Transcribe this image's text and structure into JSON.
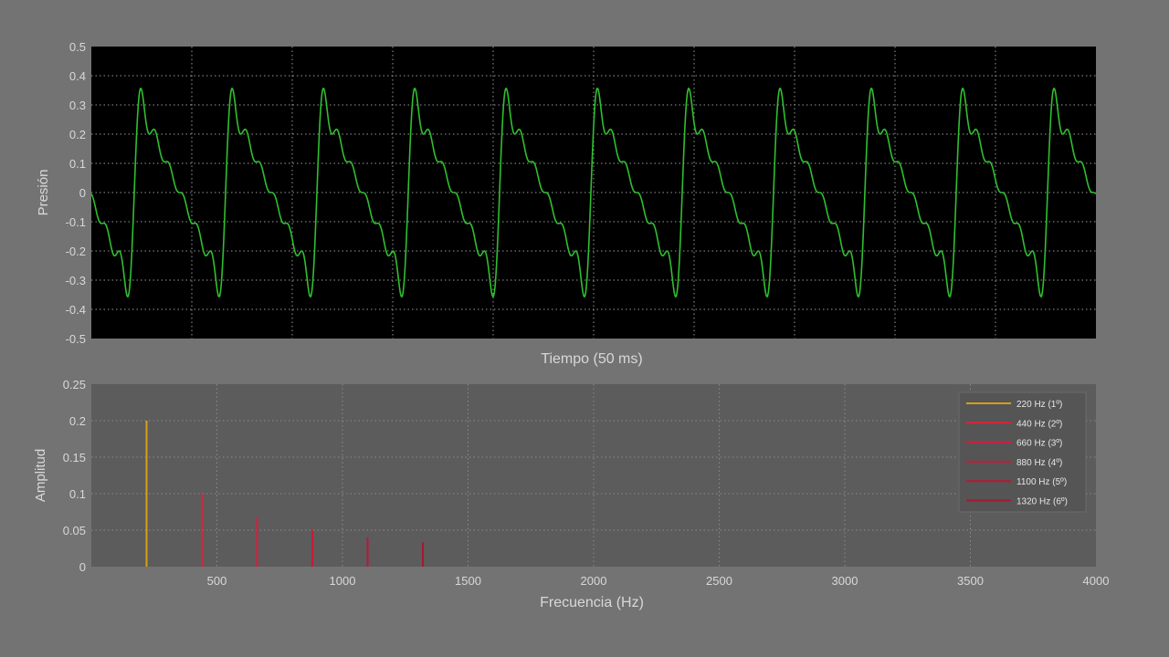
{
  "colors": {
    "background": "#737373",
    "top_plot_bg": "#000000",
    "bottom_plot_bg": "#5c5c5c",
    "wave": "#2fbf2f",
    "tick_text": "#d8d8d8",
    "fundamental": "#d4a017",
    "harmonic": "#d81b3c"
  },
  "chart_data": [
    {
      "type": "line",
      "xlabel": "Tiempo (50 ms)",
      "ylabel": "Presión",
      "ylim": [
        -0.5,
        0.5
      ],
      "yticks": [
        "0.5",
        "0.4",
        "0.3",
        "0.2",
        "0.1",
        "0",
        "-0.1",
        "-0.2",
        "-0.3",
        "-0.4",
        "-0.5"
      ],
      "xlim": [
        0,
        50
      ],
      "xticks_shown": false,
      "grid": true,
      "series": [
        {
          "function": "sum of harmonics 220 Hz fundamental, amplitudes 0.2/0.1/0.0667/0.05/0.04/0.0333",
          "fundamental_hz": 220,
          "amplitudes": [
            0.2,
            0.1,
            0.0667,
            0.05,
            0.04,
            0.0333
          ],
          "peak": 0.32,
          "trough": -0.32,
          "periods_shown": 11
        }
      ]
    },
    {
      "type": "bar",
      "xlabel": "Frecuencia (Hz)",
      "ylabel": "Amplitud",
      "xlim": [
        0,
        4000
      ],
      "ylim": [
        0,
        0.25
      ],
      "xticks": [
        "500",
        "1000",
        "1500",
        "2000",
        "2500",
        "3000",
        "3500",
        "4000"
      ],
      "yticks": [
        "0.25",
        "0.2",
        "0.15",
        "0.1",
        "0.05",
        "0"
      ],
      "grid": true,
      "legend_placement": "top-right",
      "series": [
        {
          "name": "220 Hz (1º)",
          "x": 220,
          "value": 0.2
        },
        {
          "name": "440 Hz (2º)",
          "x": 440,
          "value": 0.1
        },
        {
          "name": "660 Hz (3º)",
          "x": 660,
          "value": 0.0667
        },
        {
          "name": "880 Hz (4º)",
          "x": 880,
          "value": 0.05
        },
        {
          "name": "1100 Hz (5º)",
          "x": 1100,
          "value": 0.04
        },
        {
          "name": "1320 Hz (6º)",
          "x": 1320,
          "value": 0.0333
        }
      ]
    }
  ]
}
